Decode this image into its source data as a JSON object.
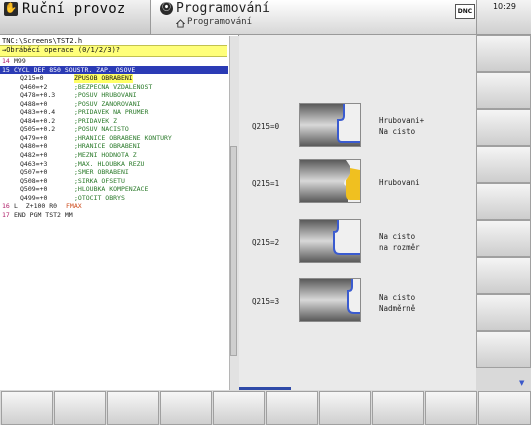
{
  "header": {
    "mode_title": "Ruční provoz",
    "program_title": "Programování",
    "program_sub": "Programování",
    "dnc_label": "DNC",
    "clock": "10:29"
  },
  "program": {
    "path": "TNC:\\Screens\\TST2.h",
    "section": "→Obráběcí operace (0/1/2/3)?",
    "lines": [
      {
        "n": "14",
        "c": "M99",
        "m": ""
      },
      {
        "n": "15",
        "c": "CYCL DEF 850 SOUSTR. ZAP. OSOVE",
        "m": ""
      },
      {
        "n": "",
        "c": "Q215=0",
        "m": "ZPUSOB OBRABENI"
      },
      {
        "n": "",
        "c": "Q460=+2",
        "m": ";BEZPECNA VZDALENOST"
      },
      {
        "n": "",
        "c": "Q478=+0.3",
        "m": ";POSUV HRUBOVANI"
      },
      {
        "n": "",
        "c": "Q488=+0",
        "m": ";POSUV ZANOROVANI"
      },
      {
        "n": "",
        "c": "Q483=+0.4",
        "m": ";PRIDAVEK NA PRUMER"
      },
      {
        "n": "",
        "c": "Q484=+0.2",
        "m": ";PRIDAVEK Z"
      },
      {
        "n": "",
        "c": "Q505=+0.2",
        "m": ";POSUV NACISTO"
      },
      {
        "n": "",
        "c": "Q479=+0",
        "m": ";HRANICE OBRABENE KONTURY"
      },
      {
        "n": "",
        "c": "Q480=+0",
        "m": ";HRANICE OBRABENI"
      },
      {
        "n": "",
        "c": "Q482=+0",
        "m": ";MEZNI HODNOTA Z"
      },
      {
        "n": "",
        "c": "Q463=+3",
        "m": ";MAX. HLOUBKA REZU"
      },
      {
        "n": "",
        "c": "Q507=+0",
        "m": ";SMER OBRABENI"
      },
      {
        "n": "",
        "c": "Q508=+0",
        "m": ";SIRKA OFSETU"
      },
      {
        "n": "",
        "c": "Q509=+0",
        "m": ";HLOUBKA KOMPENZACE"
      },
      {
        "n": "",
        "c": "Q499=+0",
        "m": ";OTOCIT OBRYS"
      },
      {
        "n": "16",
        "c": "L  Z+100 R0 ",
        "m": "FMAX"
      },
      {
        "n": "17",
        "c": "END PGM TST2 MM",
        "m": ""
      }
    ]
  },
  "help": {
    "options": [
      {
        "label": "Q215=0",
        "desc1": "Hrubovani+",
        "desc2": "Na cisto"
      },
      {
        "label": "Q215=1",
        "desc1": "Hrubovani",
        "desc2": ""
      },
      {
        "label": "Q215=2",
        "desc1": "Na cisto",
        "desc2": "na rozměr"
      },
      {
        "label": "Q215=3",
        "desc1": "Na cisto",
        "desc2": "Nadměrně"
      }
    ]
  },
  "colors": {
    "selection": "#2b3bb5",
    "input_highlight": "#ffff66",
    "section_bar": "#ffff7a",
    "contour_blue": "#3a5bd0",
    "material_yellow": "#f0c020"
  }
}
